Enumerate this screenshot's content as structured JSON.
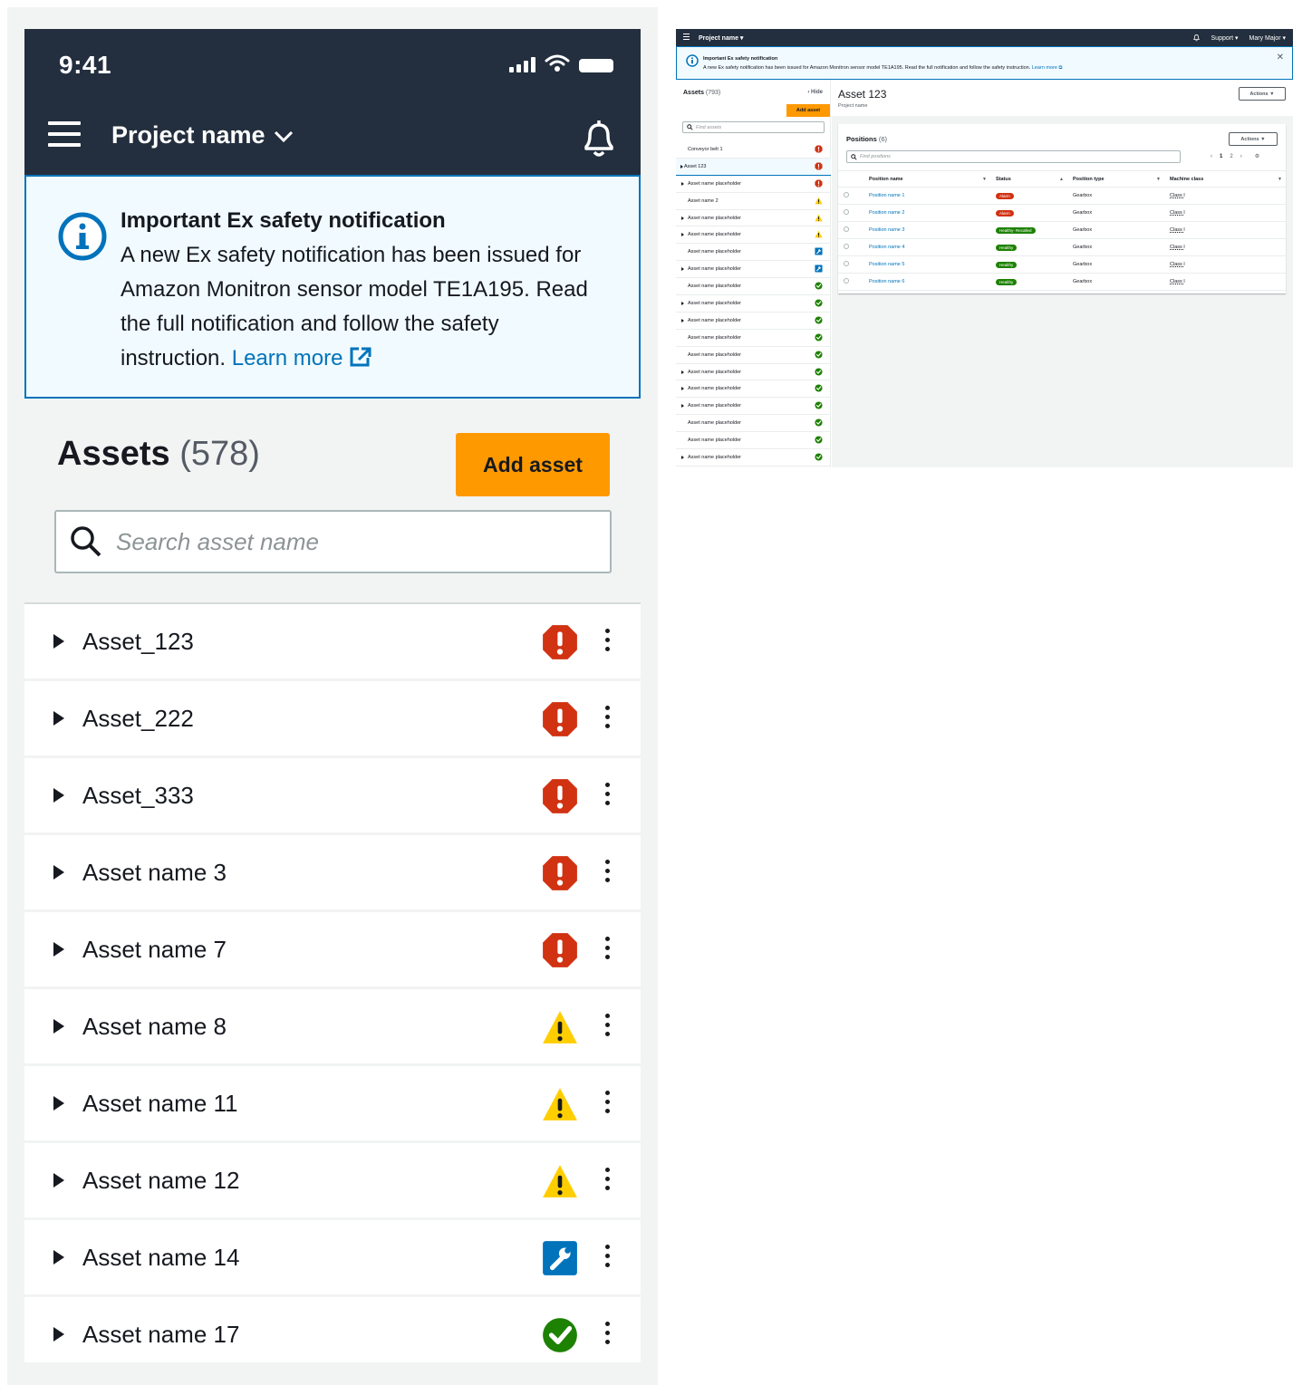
{
  "mobile": {
    "time": "9:41",
    "project_name": "Project name",
    "flash": {
      "title": "Important Ex safety notification",
      "body": "A new Ex safety notification has been issued for Amazon Monitron sensor model TE1A195. Read the full notification and follow the safety instruction.",
      "link": "Learn more"
    },
    "assets_title": "Assets",
    "assets_count": "(578)",
    "add_asset_label": "Add asset",
    "search_placeholder": "Search asset name",
    "rows": [
      {
        "label": "Asset_123",
        "status": "alarm"
      },
      {
        "label": "Asset_222",
        "status": "alarm"
      },
      {
        "label": "Asset_333",
        "status": "alarm"
      },
      {
        "label": "Asset name 3",
        "status": "alarm"
      },
      {
        "label": "Asset name 7",
        "status": "alarm"
      },
      {
        "label": "Asset name 8",
        "status": "warning"
      },
      {
        "label": "Asset name 11",
        "status": "warning"
      },
      {
        "label": "Asset name 12",
        "status": "warning"
      },
      {
        "label": "Asset name 14",
        "status": "maintenance"
      },
      {
        "label": "Asset name 17",
        "status": "healthy"
      }
    ]
  },
  "desktop": {
    "project_name": "Project name",
    "support_label": "Support",
    "user_label": "Mary Major",
    "flash": {
      "title": "Important Ex safety notification",
      "body": "A new Ex safety notification has been issued for Amazon Monitron sensor model TE1A195. Read the full notification and follow the safety instruction.",
      "link": "Learn more"
    },
    "sidebar": {
      "title": "Assets",
      "count": "(793)",
      "hide_label": "Hide",
      "add_asset_label": "Add asset",
      "find_placeholder": "Find assets",
      "rows": [
        {
          "label": "Conveyor belt 1",
          "expandable": false,
          "status": "alarm",
          "selected": false
        },
        {
          "label": "Asset 123",
          "expandable": true,
          "status": "alarm",
          "selected": true
        },
        {
          "label": "Asset name placeholder",
          "expandable": true,
          "status": "alarm",
          "selected": false
        },
        {
          "label": "Asset name 2",
          "expandable": false,
          "status": "warning",
          "selected": false
        },
        {
          "label": "Asset name placeholder",
          "expandable": true,
          "status": "warning",
          "selected": false
        },
        {
          "label": "Asset name placeholder",
          "expandable": true,
          "status": "warning",
          "selected": false
        },
        {
          "label": "Asset name placeholder",
          "expandable": false,
          "status": "maintenance",
          "selected": false
        },
        {
          "label": "Asset name placeholder",
          "expandable": true,
          "status": "maintenance",
          "selected": false
        },
        {
          "label": "Asset name placeholder",
          "expandable": false,
          "status": "healthy",
          "selected": false
        },
        {
          "label": "Asset name placeholder",
          "expandable": true,
          "status": "healthy",
          "selected": false
        },
        {
          "label": "Asset name placeholder",
          "expandable": true,
          "status": "healthy",
          "selected": false
        },
        {
          "label": "Asset name placeholder",
          "expandable": false,
          "status": "healthy",
          "selected": false
        },
        {
          "label": "Asset name placeholder",
          "expandable": false,
          "status": "healthy",
          "selected": false
        },
        {
          "label": "Asset name placeholder",
          "expandable": true,
          "status": "healthy",
          "selected": false
        },
        {
          "label": "Asset name placeholder",
          "expandable": true,
          "status": "healthy",
          "selected": false
        },
        {
          "label": "Asset name placeholder",
          "expandable": true,
          "status": "healthy",
          "selected": false
        },
        {
          "label": "Asset name placeholder",
          "expandable": false,
          "status": "healthy",
          "selected": false
        },
        {
          "label": "Asset name placeholder",
          "expandable": false,
          "status": "healthy",
          "selected": false
        },
        {
          "label": "Asset name placeholder",
          "expandable": true,
          "status": "healthy",
          "selected": false
        }
      ]
    },
    "main": {
      "asset_title": "Asset 123",
      "asset_subtitle": "Project name",
      "actions_label": "Actions",
      "positions_title": "Positions",
      "positions_count": "(6)",
      "positions_actions_label": "Actions",
      "find_positions_placeholder": "Find positions",
      "pages": [
        "1",
        "2"
      ],
      "columns": [
        "Position name",
        "Status",
        "Position type",
        "Machine class"
      ],
      "rows": [
        {
          "name": "Position name 1",
          "status": "Alarm",
          "status_kind": "alarm",
          "type": "Gearbox",
          "class": "Class I"
        },
        {
          "name": "Position name 2",
          "status": "Alarm",
          "status_kind": "alarm",
          "type": "Gearbox",
          "class": "Class I"
        },
        {
          "name": "Position name 3",
          "status": "Healthy- Recalled",
          "status_kind": "healthy",
          "type": "Gearbox",
          "class": "Class I"
        },
        {
          "name": "Position name 4",
          "status": "Healthy",
          "status_kind": "healthy",
          "type": "Gearbox",
          "class": "Class I"
        },
        {
          "name": "Position name 5",
          "status": "Healthy",
          "status_kind": "healthy",
          "type": "Gearbox",
          "class": "Class I"
        },
        {
          "name": "Position name 6",
          "status": "Healthy",
          "status_kind": "healthy",
          "type": "Gearbox",
          "class": "Class I"
        }
      ]
    }
  },
  "colors": {
    "header_bg": "#232f3e",
    "accent_orange": "#ff9900",
    "link_blue": "#0073bb",
    "alarm_red": "#d13212",
    "warning_yellow": "#ffce00",
    "maintenance_blue": "#0073bb",
    "healthy_green": "#1d8102"
  }
}
